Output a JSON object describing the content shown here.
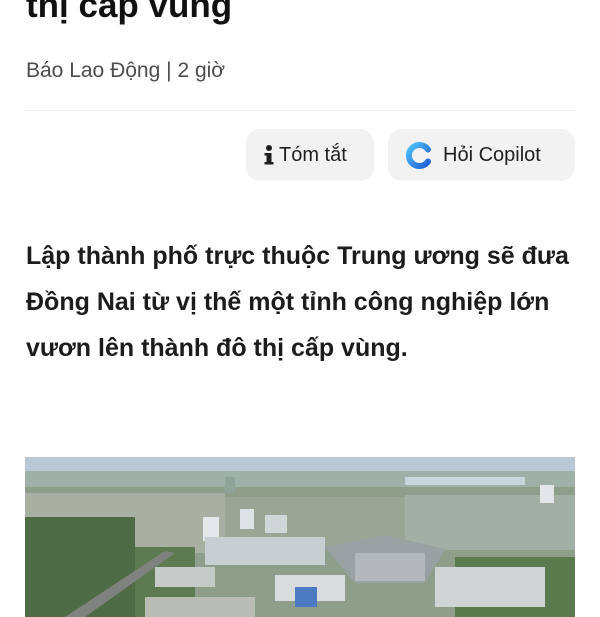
{
  "article": {
    "headline_tail": "thị cấp vùng",
    "source": "Báo Lao Động",
    "separator": "|",
    "time": "2 giờ",
    "lead": "Lập thành phố trực thuộc Trung ương sẽ đưa Đồng Nai từ vị thế một tỉnh công nghiệp lớn vươn lên thành đô thị cấp vùng."
  },
  "actions": {
    "summary_label": "Tóm tắt",
    "summary_icon": "info-icon",
    "copilot_label": "Hỏi Copilot",
    "copilot_icon": "copilot-icon"
  },
  "image": {
    "subject": "aerial-photo-industrial-city"
  },
  "colors": {
    "chip_background": "#f2f2f2",
    "byline_text": "#4d4d4d",
    "copilot_blue": "#1e88e5",
    "copilot_cyan": "#4fc3f7"
  }
}
